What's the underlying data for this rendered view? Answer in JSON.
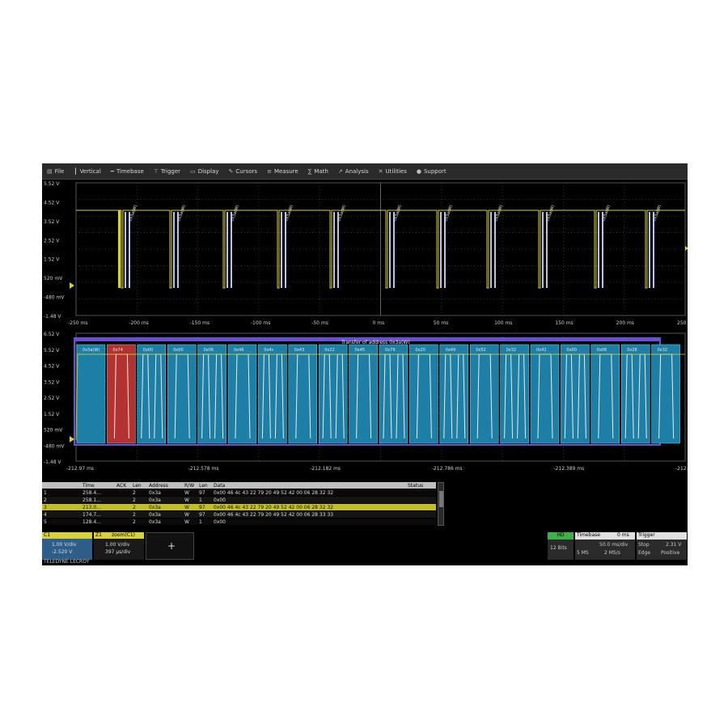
{
  "menu": [
    {
      "label": "File",
      "icon": "file-icon"
    },
    {
      "label": "Vertical",
      "icon": "vertical-icon"
    },
    {
      "label": "Timebase",
      "icon": "timebase-icon"
    },
    {
      "label": "Trigger",
      "icon": "trigger-icon"
    },
    {
      "label": "Display",
      "icon": "display-icon"
    },
    {
      "label": "Cursors",
      "icon": "cursors-icon"
    },
    {
      "label": "Measure",
      "icon": "measure-icon"
    },
    {
      "label": "Math",
      "icon": "math-icon"
    },
    {
      "label": "Analysis",
      "icon": "analysis-icon"
    },
    {
      "label": "Utilities",
      "icon": "utilities-icon"
    },
    {
      "label": "Support",
      "icon": "support-icon"
    }
  ],
  "top_grid": {
    "y_labels": [
      "5.52 V",
      "4.52 V",
      "3.52 V",
      "2.52 V",
      "1.52 V",
      "520 mV",
      "-480 mV",
      "-1.48 V"
    ],
    "x_labels": [
      "-250 ms",
      "-200 ms",
      "-150 ms",
      "-100 ms",
      "-50 ms",
      "0 ms",
      "50 ms",
      "100 ms",
      "150 ms",
      "200 ms",
      "250 ms"
    ]
  },
  "zoom_grid": {
    "y_labels": [
      "6.52 V",
      "5.52 V",
      "4.52 V",
      "3.52 V",
      "2.52 V",
      "1.52 V",
      "520 mV",
      "-480 mV",
      "-1.48 V"
    ],
    "x_labels": [
      "-212.97 ms",
      "-212.578 ms",
      "-212.182 ms",
      "-212.786 ms",
      "-212.389 ms",
      "-212.991 ms"
    ],
    "transfer_label": "Transfer of address 0x3a(W)",
    "decode_labels": [
      "0x3a(W)",
      "0x74",
      "0x00",
      "0x00",
      "0x06",
      "0x46",
      "0x4c",
      "0x43",
      "0x22",
      "0x45",
      "0x79",
      "0x20",
      "0x49",
      "0x52",
      "0x32",
      "0x42",
      "0x00",
      "0x06",
      "0x28",
      "0x32"
    ]
  },
  "table": {
    "headers": [
      "",
      "Time",
      "ACK",
      "Len",
      "Address",
      "R/W",
      "Len",
      "Data",
      "Status"
    ],
    "rows": [
      [
        "1",
        "258.4...",
        "",
        "2",
        "0x3a",
        "W",
        "97",
        "0x00 46 4c 43 22 79 20 49 52 42 00 06 28 32 32",
        ""
      ],
      [
        "2",
        "258.1...",
        "",
        "2",
        "0x3a",
        "W",
        "1",
        "0x00",
        ""
      ],
      [
        "3",
        "213.0...",
        "",
        "2",
        "0x3a",
        "W",
        "97",
        "0x00 46 4c 43 22 79 20 49 52 42 00 06 28 32 32",
        ""
      ],
      [
        "4",
        "174.7...",
        "",
        "2",
        "0x3a",
        "W",
        "97",
        "0x00 46 4c 43 22 79 20 49 52 42 00 06 28 33 33",
        ""
      ],
      [
        "5",
        "128.4...",
        "",
        "2",
        "0x3a",
        "W",
        "1",
        "0x00",
        ""
      ]
    ]
  },
  "channels": {
    "c1": {
      "name": "C1",
      "volts_div": "1.00 V/div",
      "offset": "-2.520 V"
    },
    "z1": {
      "name": "Z1",
      "source": "zoom(C1)",
      "volts_div": "1.00 V/div",
      "time_div": "397 µs/div"
    },
    "add_button": "+"
  },
  "status": {
    "hd_badge": "HD",
    "bits": "12 Bits",
    "timebase_label": "Timebase",
    "timebase_value": "0 ms",
    "timebase_div": "50.0 ms/div",
    "samples": "5 MS",
    "sample_rate": "2 MS/s",
    "trigger_label": "Trigger",
    "trigger_mode": "Stop",
    "trigger_type": "Edge",
    "trigger_level": "2.31 V",
    "trigger_slope": "Positive"
  },
  "brand": "TELEDYNE LECROY",
  "colors": {
    "trace_yellow": "#d8cf3a",
    "decode_blue": "#1d7fa5",
    "decode_red": "#b3322f",
    "bracket_purple": "#6d4fd6",
    "selected_row": "#c2c01c"
  }
}
